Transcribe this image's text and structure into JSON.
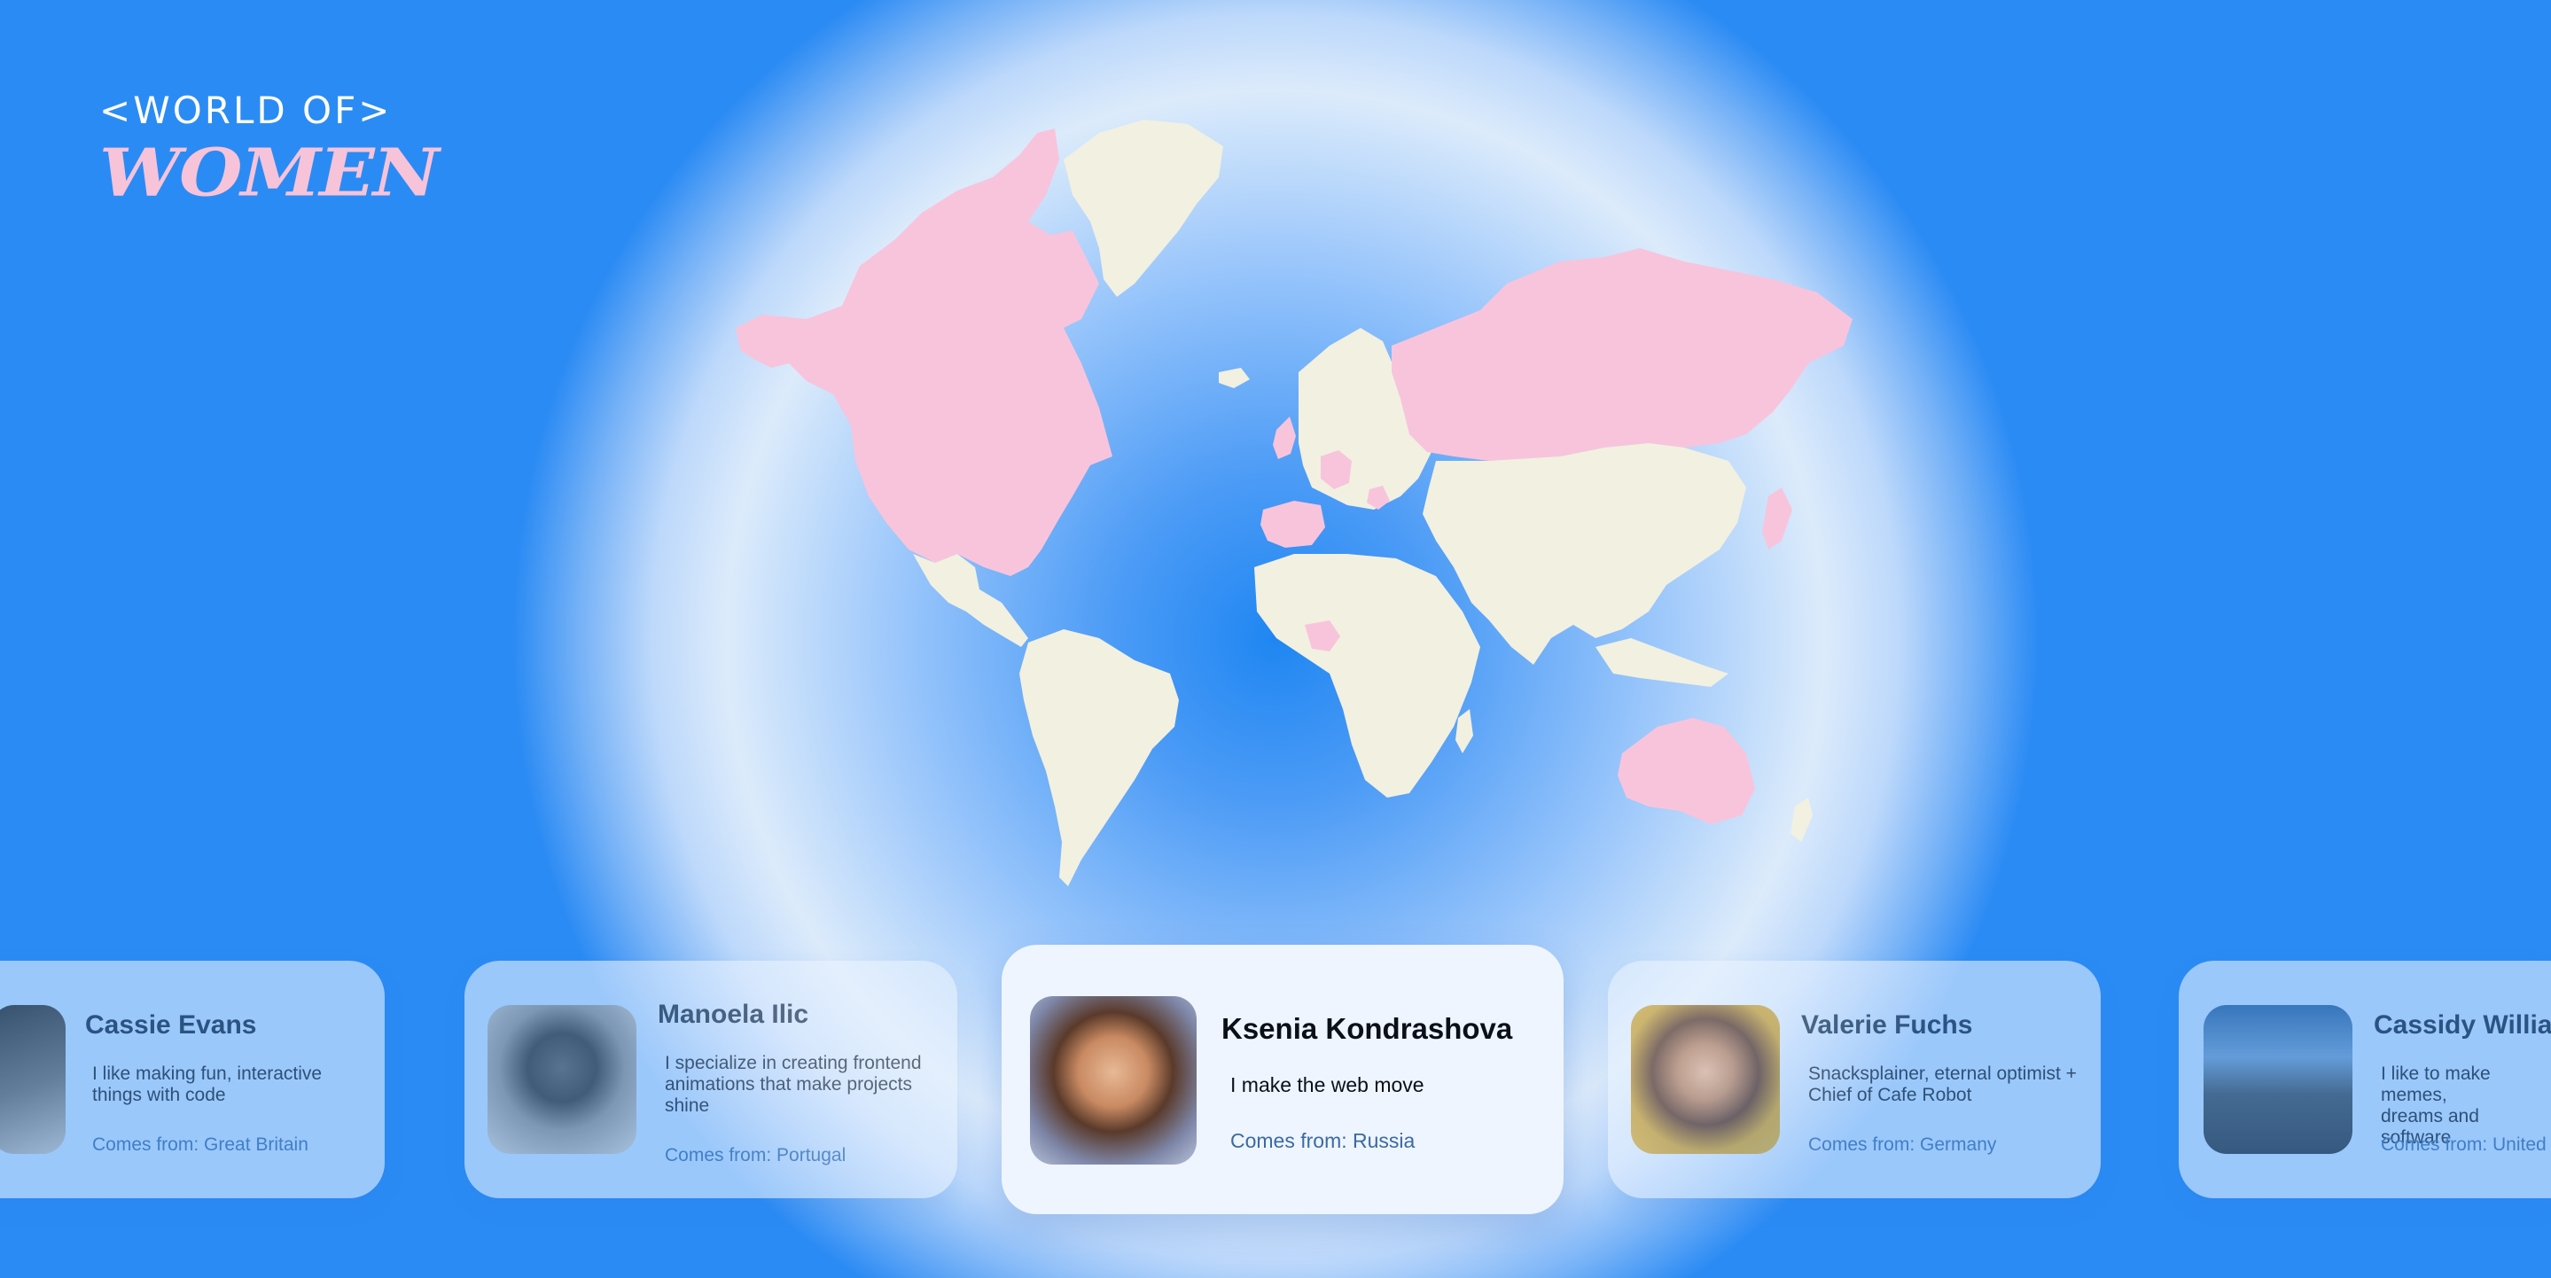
{
  "logo": {
    "line1": "<WORLD OF>",
    "line2": "WOMEN"
  },
  "colors": {
    "background_accent": "#1f86f2",
    "highlight_country": "#f8c4dc",
    "other_country": "#f2f0e1",
    "logo_pink": "#f7c3d9"
  },
  "map": {
    "highlighted_countries": [
      "USA",
      "Canada",
      "Great Britain",
      "Portugal",
      "Spain",
      "Germany",
      "Russia",
      "Serbia",
      "Nigeria",
      "Australia"
    ]
  },
  "cards": [
    {
      "name": "Cassie Evans",
      "bio": "I like making fun, interactive\nthings with code",
      "from": "Comes from: Great Britain"
    },
    {
      "name": "Manoela Ilic",
      "bio": "I specialize in creating frontend\nanimations that make projects\nshine",
      "from": "Comes from: Portugal"
    },
    {
      "name": "Ksenia Kondrashova",
      "bio": "I make the web move",
      "from": "Comes from: Russia"
    },
    {
      "name": "Valerie Fuchs",
      "bio": "Snacksplainer, eternal optimist +\nChief of Cafe Robot",
      "from": "Comes from: Germany"
    },
    {
      "name": "Cassidy Williams",
      "bio": "I like to make memes,\ndreams and software",
      "from": "Comes from: United States"
    }
  ]
}
